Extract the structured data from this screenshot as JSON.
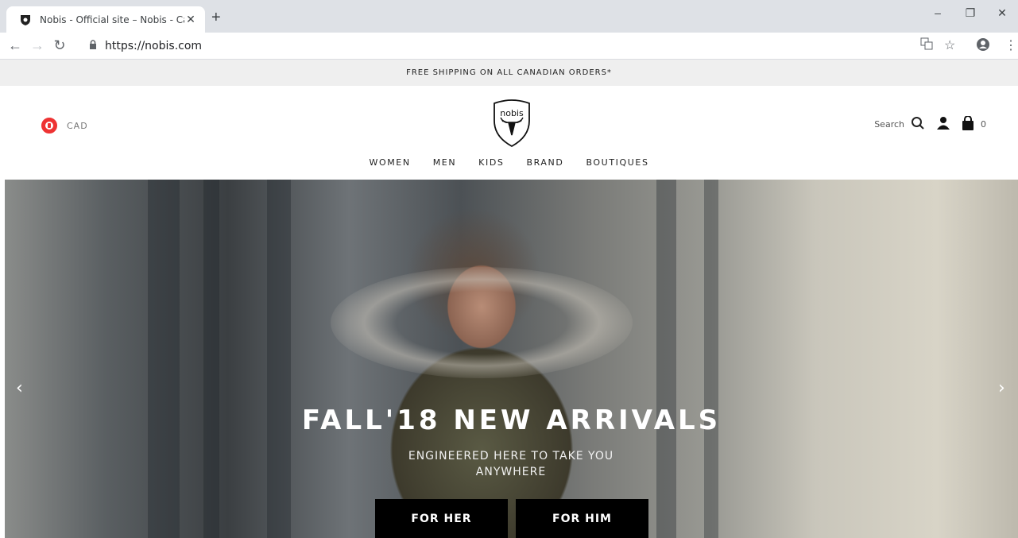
{
  "browser": {
    "tab_title": "Nobis - Official site – Nobis - Car",
    "tab_close": "✕",
    "new_tab": "+",
    "url": "https://nobis.com",
    "window_minimize": "–",
    "window_restore": "❐",
    "window_close": "✕"
  },
  "promo": {
    "text": "FREE SHIPPING ON ALL CANADIAN ORDERS*"
  },
  "header": {
    "currency": "CAD",
    "logo_text": "nobis",
    "search_label": "Search",
    "cart_count": "0",
    "nav": [
      "WOMEN",
      "MEN",
      "KIDS",
      "BRAND",
      "BOUTIQUES"
    ]
  },
  "hero": {
    "title": "FALL'18 NEW ARRIVALS",
    "subtitle_line1": "ENGINEERED HERE TO TAKE YOU",
    "subtitle_line2": "ANYWHERE",
    "button_her": "FOR HER",
    "button_him": "FOR HIM",
    "prev_arrow": "‹",
    "next_arrow": "›"
  }
}
